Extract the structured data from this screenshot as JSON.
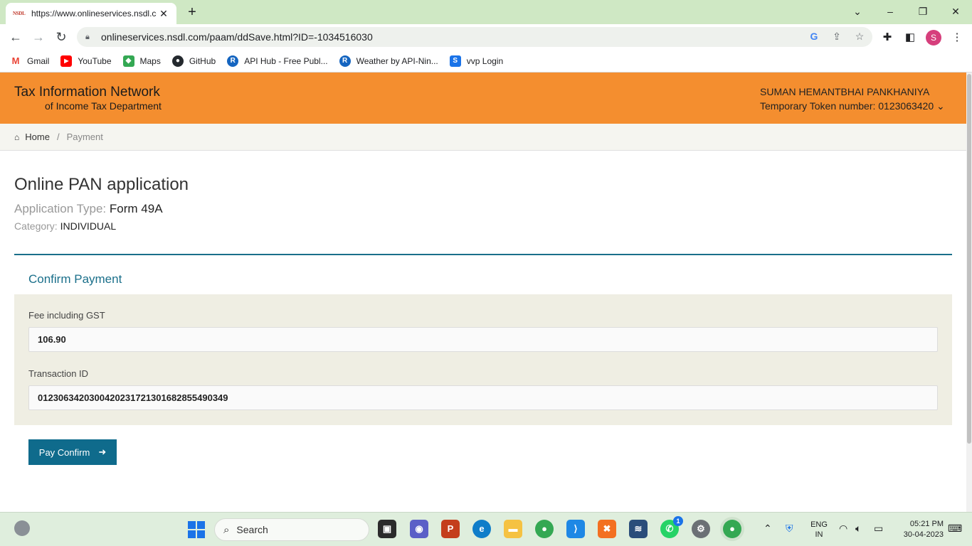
{
  "browser": {
    "tab_title": "https://www.onlineservices.nsdl.com",
    "tab_favicon_text": "NSDL",
    "url": "onlineservices.nsdl.com/paam/ddSave.html?ID=-1034516030",
    "profile_initial": "S"
  },
  "bookmarks": [
    {
      "label": "Gmail",
      "icon": "gmail-icon",
      "color": "#ea4335"
    },
    {
      "label": "YouTube",
      "icon": "youtube-icon",
      "color": "#ff0000"
    },
    {
      "label": "Maps",
      "icon": "maps-icon",
      "color": "#34a853"
    },
    {
      "label": "GitHub",
      "icon": "github-icon",
      "color": "#24292e"
    },
    {
      "label": "API Hub - Free Publ...",
      "icon": "rapidapi-icon",
      "color": "#1565c0"
    },
    {
      "label": "Weather by API-Nin...",
      "icon": "rapidapi-icon",
      "color": "#1565c0"
    },
    {
      "label": "vvp Login",
      "icon": "s-logo-icon",
      "color": "#1a73e8"
    }
  ],
  "header": {
    "logo_line1": "Tax Information Network",
    "logo_line2": "of Income Tax Department",
    "user_name": "SUMAN HEMANTBHAI PANKHANIYA",
    "token_line": "Temporary Token number: 0123063420 ⌄"
  },
  "breadcrumb": {
    "home": "Home",
    "separator": "/",
    "current": "Payment"
  },
  "page": {
    "title": "Online PAN application",
    "application_type_label": "Application Type:",
    "application_type_value": "Form 49A",
    "category_label": "Category:",
    "category_value": "INDIVIDUAL"
  },
  "confirm_payment": {
    "section_title": "Confirm Payment",
    "fee_label": "Fee including GST",
    "fee_value": "106.90",
    "transaction_label": "Transaction ID",
    "transaction_value": "0123063420300420231721301682855490349",
    "button_label": "Pay Confirm"
  },
  "taskbar": {
    "search_text": "Search",
    "whatsapp_badge": "1",
    "lang_line1": "ENG",
    "lang_line2": "IN",
    "time": "05:21 PM",
    "date": "30-04-2023"
  },
  "colors": {
    "header_orange": "#f48e2f",
    "accent_teal": "#0f6b8c",
    "panel_bg": "#efeee3"
  }
}
